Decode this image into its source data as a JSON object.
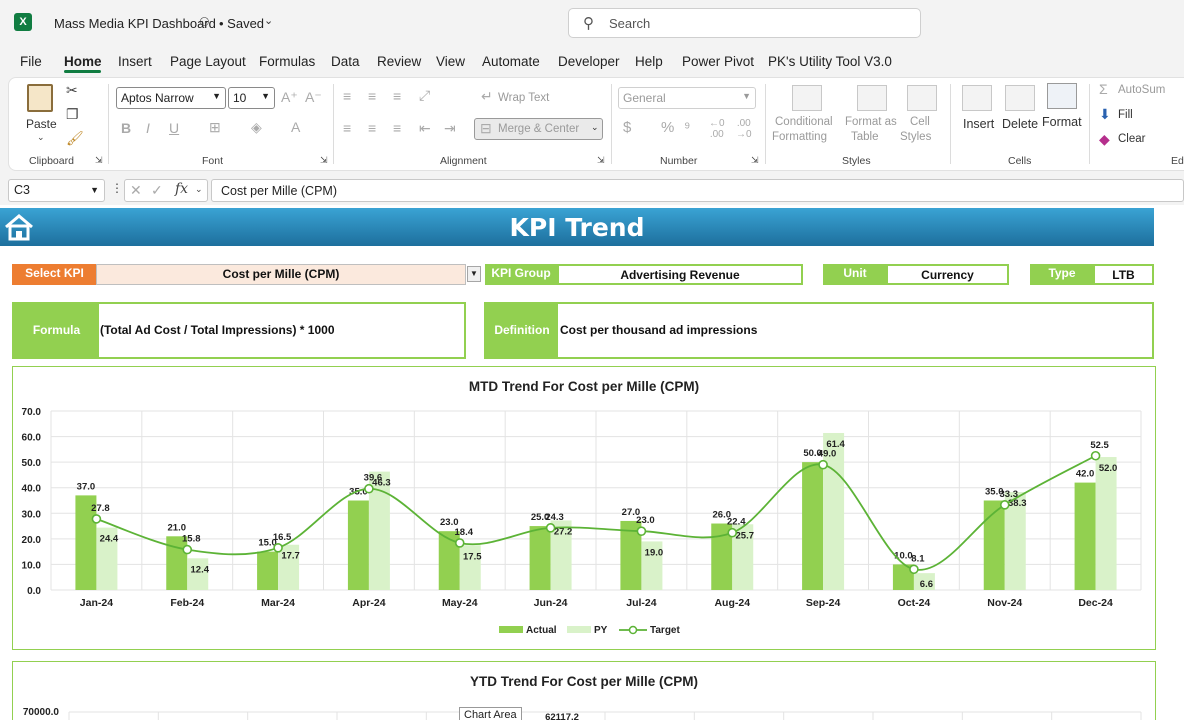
{
  "app": {
    "title": "Mass Media KPI Dashboard",
    "saved": "• Saved",
    "search_placeholder": "Search"
  },
  "tabs": [
    "File",
    "Home",
    "Insert",
    "Page Layout",
    "Formulas",
    "Data",
    "Review",
    "View",
    "Automate",
    "Developer",
    "Help",
    "Power Pivot",
    "PK's Utility Tool V3.0"
  ],
  "ribbon": {
    "clipboard": {
      "paste": "Paste",
      "label": "Clipboard"
    },
    "font": {
      "name": "Aptos Narrow",
      "size": "10",
      "label": "Font"
    },
    "alignment": {
      "wrap_text": "Wrap Text",
      "merge_center": "Merge & Center",
      "label": "Alignment"
    },
    "number": {
      "format": "General",
      "label": "Number"
    },
    "styles": {
      "conditional": "Conditional",
      "formatting": "Formatting",
      "format_as": "Format as",
      "table": "Table",
      "cell": "Cell",
      "styles_word": "Styles",
      "label": "Styles"
    },
    "cells": {
      "insert": "Insert",
      "delete": "Delete",
      "format": "Format",
      "label": "Cells"
    },
    "editing": {
      "autosum": "AutoSum",
      "fill": "Fill",
      "clear": "Clear",
      "label": "Edi"
    }
  },
  "formula_bar": {
    "name_box": "C3",
    "content": "Cost per Mille (CPM)"
  },
  "dashboard": {
    "title": "KPI Trend",
    "select_kpi_label": "Select KPI",
    "select_kpi_value": "Cost per Mille (CPM)",
    "kpi_group_label": "KPI Group",
    "kpi_group_value": "Advertising Revenue",
    "unit_label": "Unit",
    "unit_value": "Currency",
    "type_label": "Type",
    "type_value": "LTB",
    "formula_label": "Formula",
    "formula_value": "(Total Ad Cost / Total Impressions) * 1000",
    "definition_label": "Definition",
    "definition_value": "Cost per thousand ad impressions"
  },
  "chart_data": [
    {
      "type": "bar",
      "title": "MTD Trend For Cost per Mille (CPM)",
      "categories": [
        "Jan-24",
        "Feb-24",
        "Mar-24",
        "Apr-24",
        "May-24",
        "Jun-24",
        "Jul-24",
        "Aug-24",
        "Sep-24",
        "Oct-24",
        "Nov-24",
        "Dec-24"
      ],
      "ylim": [
        0,
        70
      ],
      "yticks": [
        "0.0",
        "10.0",
        "20.0",
        "30.0",
        "40.0",
        "50.0",
        "60.0",
        "70.0"
      ],
      "grid": true,
      "legend": "bottom",
      "series": [
        {
          "name": "Actual",
          "type": "bar",
          "color": "#92d050",
          "values": [
            37.0,
            21.0,
            15.0,
            35.0,
            23.0,
            25.0,
            27.0,
            26.0,
            50.0,
            10.0,
            35.0,
            42.0
          ]
        },
        {
          "name": "PY",
          "type": "bar",
          "color": "#d9f2c9",
          "values": [
            24.4,
            12.4,
            17.7,
            46.3,
            17.5,
            27.2,
            19.0,
            25.7,
            61.4,
            6.6,
            38.3,
            52.0
          ]
        },
        {
          "name": "Target",
          "type": "line",
          "color": "#5cb336",
          "values": [
            27.8,
            15.8,
            16.5,
            39.6,
            18.4,
            24.3,
            23.0,
            22.4,
            49.0,
            8.1,
            33.3,
            52.5
          ]
        }
      ]
    },
    {
      "type": "bar",
      "title": "YTD Trend For Cost per Mille (CPM)",
      "ylim": [
        0,
        70000
      ],
      "yticks": [
        "70000.0"
      ],
      "visible_labels": [
        "62117.2"
      ],
      "tooltip": "Chart Area"
    }
  ]
}
